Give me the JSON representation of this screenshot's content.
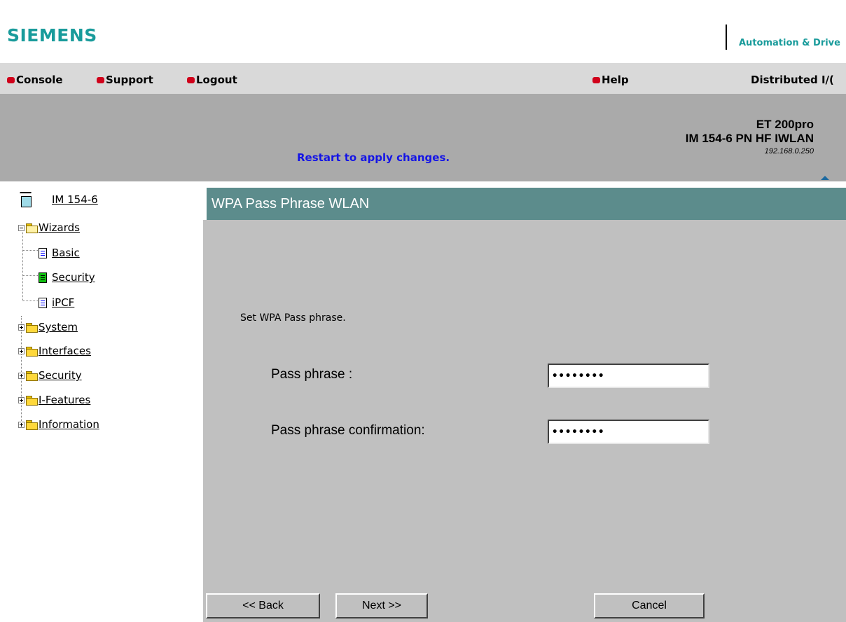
{
  "brand": {
    "logo": "SIEMENS",
    "subtitle": "Automation & Drive"
  },
  "nav": {
    "items": [
      {
        "label": "Console"
      },
      {
        "label": "Support"
      },
      {
        "label": "Logout"
      }
    ],
    "help": "Help",
    "section": "Distributed I/("
  },
  "header": {
    "notice": "Restart to apply changes.",
    "device_family": "ET 200pro",
    "device_model": "IM 154-6 PN HF IWLAN",
    "ip": "192.168.0.250"
  },
  "tree": {
    "root": "IM 154-6",
    "wizards": "Wizards",
    "basic": "Basic",
    "security_wizard": "Security",
    "ipcf": "iPCF",
    "system": "System",
    "interfaces": "Interfaces",
    "security": "Security",
    "ifeatures": "I-Features",
    "information": "Information"
  },
  "page": {
    "title": "WPA Pass Phrase WLAN",
    "instruction": "Set WPA Pass phrase.",
    "pass_label": "Pass phrase :",
    "pass_value": "••••••••",
    "confirm_label": "Pass phrase confirmation:",
    "confirm_value": "••••••••"
  },
  "buttons": {
    "back": "<< Back",
    "next": "Next >>",
    "cancel": "Cancel"
  },
  "colors": {
    "brand": "#199b9b",
    "title_bar": "#5c8c8c",
    "notice": "#1414e6",
    "nav_bullet": "#d0021b"
  }
}
